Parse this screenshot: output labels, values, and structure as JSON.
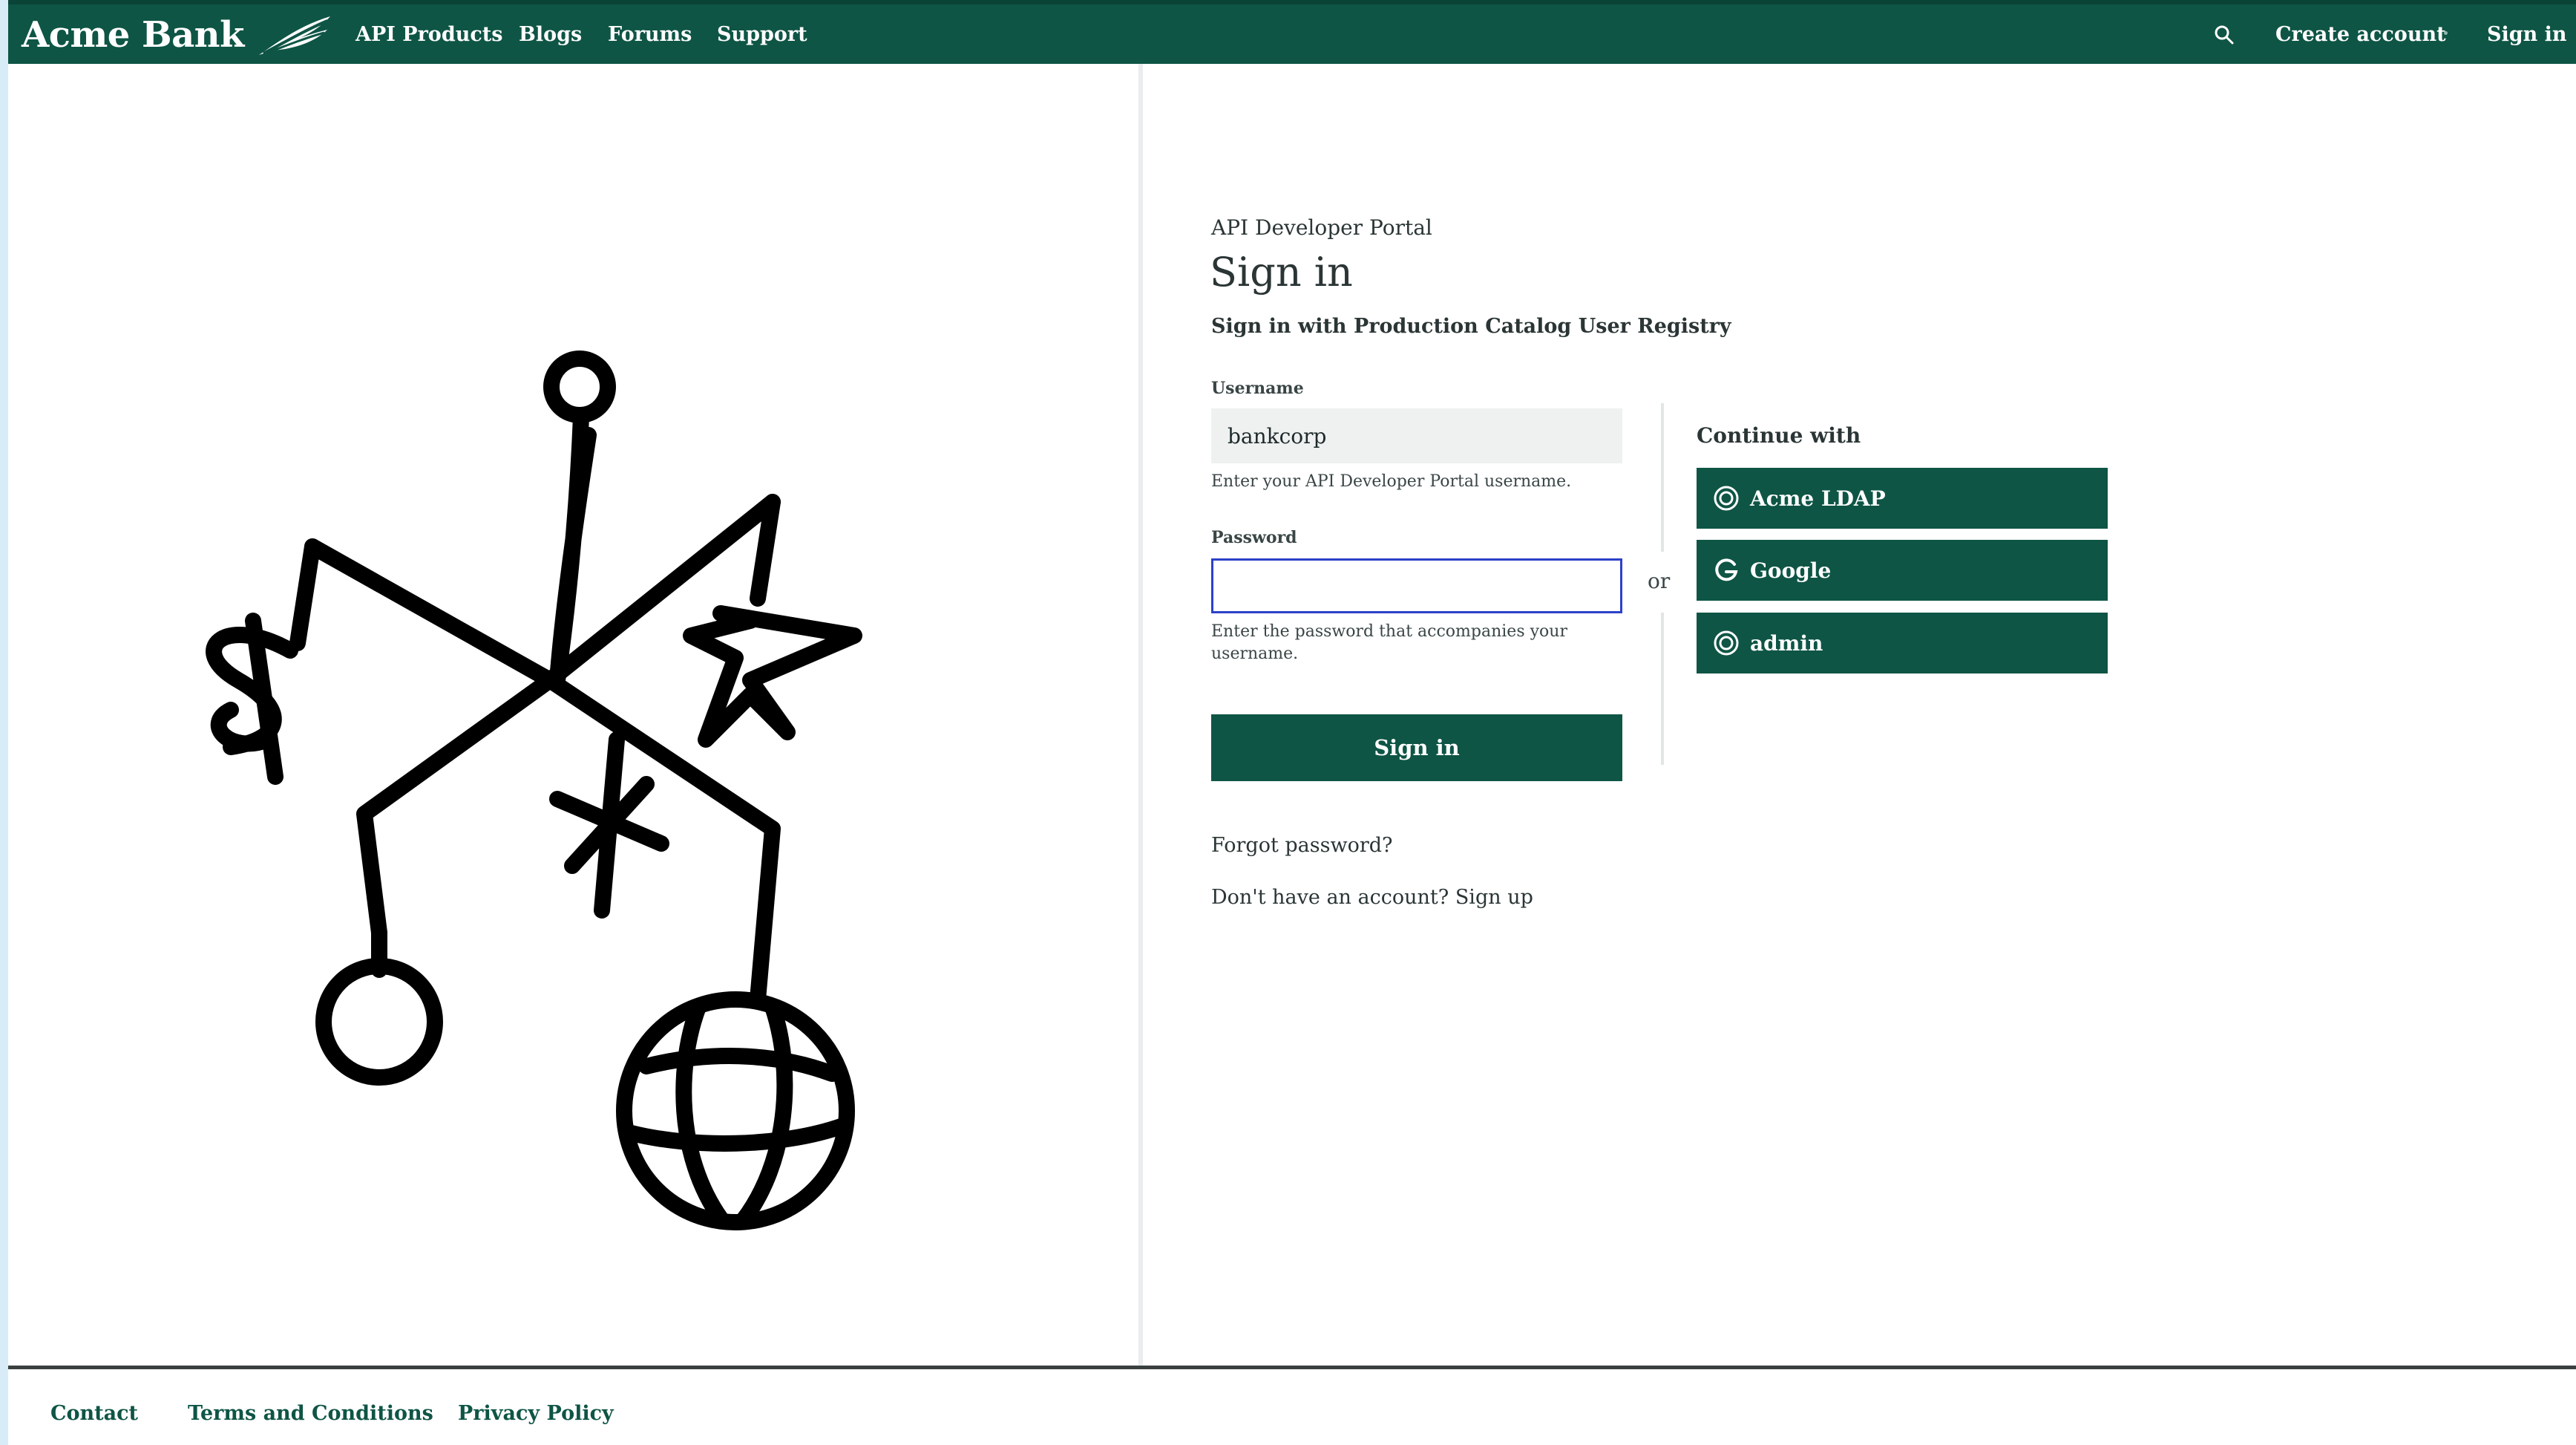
{
  "header": {
    "brand": "Acme Bank",
    "nav": [
      "API Products",
      "Blogs",
      "Forums",
      "Support"
    ],
    "create_account": "Create account",
    "sign_in": "Sign in"
  },
  "form": {
    "portal": "API Developer Portal",
    "title": "Sign in",
    "registry": "Sign in with Production Catalog User Registry",
    "username_label": "Username",
    "username_value": "bankcorp",
    "username_help": "Enter your API Developer Portal username.",
    "password_label": "Password",
    "password_value": "",
    "password_help": "Enter the password that accompanies your username.",
    "submit": "Sign in",
    "forgot": "Forgot password?",
    "no_account": "Don't have an account?",
    "sign_up": "Sign up"
  },
  "divider": {
    "or": "or"
  },
  "providers": {
    "heading": "Continue with",
    "items": [
      {
        "label": "Acme LDAP",
        "icon": "ldap-icon"
      },
      {
        "label": "Google",
        "icon": "google-icon"
      },
      {
        "label": "admin",
        "icon": "ldap-icon"
      }
    ]
  },
  "footer": {
    "links": [
      "Contact",
      "Terms and Conditions",
      "Privacy Policy"
    ]
  },
  "colors": {
    "brand_green": "#0e5545",
    "focus_blue": "#2c41c9",
    "backdrop": "#d7ecf7"
  }
}
